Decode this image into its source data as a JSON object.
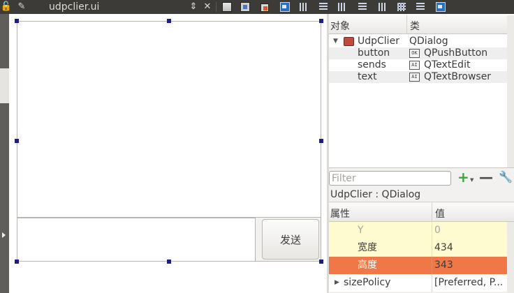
{
  "toolbar": {
    "title": "udpclier.ui"
  },
  "form": {
    "button_label": "发送"
  },
  "object_inspector": {
    "col_object": "对象",
    "col_class": "类",
    "root": {
      "name": "UdpClier",
      "class": "QDialog"
    },
    "children": [
      {
        "name": "button",
        "class": "QPushButton",
        "icon_text": "OK"
      },
      {
        "name": "sends",
        "class": "QTextEdit",
        "icon_text": "AI"
      },
      {
        "name": "text",
        "class": "QTextBrowser",
        "icon_text": "AI"
      }
    ]
  },
  "filter": {
    "placeholder": "Filter"
  },
  "selected_object": "UdpClier : QDialog",
  "property_editor": {
    "col_property": "属性",
    "col_value": "值",
    "rows": [
      {
        "name": "Y",
        "value": "0"
      },
      {
        "name": "宽度",
        "value": "434"
      },
      {
        "name": "高度",
        "value": "343"
      },
      {
        "name": "sizePolicy",
        "value": "[Preferred, P..."
      }
    ]
  },
  "colors": {
    "toolbar_bg": "#3c3b37",
    "selection": "#f07746",
    "property_row": "#fffbd1",
    "handle": "#1c1c8a"
  }
}
